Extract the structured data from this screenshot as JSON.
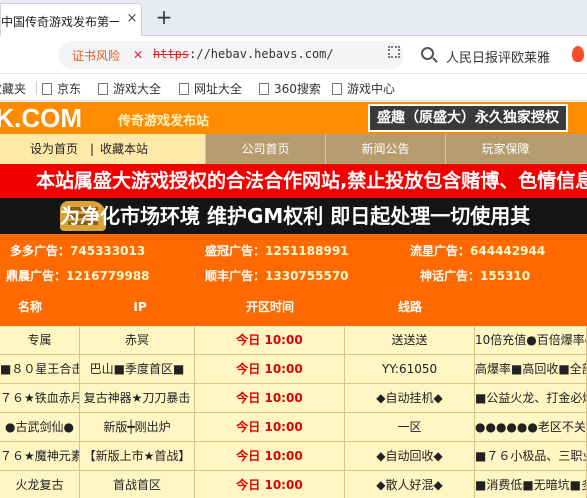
{
  "browser": {
    "tab_title": "中国传奇游戏发布第一",
    "tab_close": "×",
    "new_tab": "+",
    "risk_label": "证书风险",
    "url_scheme": "https",
    "url_rest": "://hebav.hebavs.com/",
    "search_text": "人民日报评欧莱雅",
    "bookmarks": [
      "收藏夹",
      "京东",
      "游戏大全",
      "网址大全",
      "360搜索",
      "游戏中心"
    ]
  },
  "site": {
    "logo": "PK.COM",
    "slogan": "传奇游戏发布站",
    "auth": "盛趣（原盛大）永久独家授权",
    "nav_left": [
      "设为首页",
      "|",
      "收藏本站"
    ],
    "nav_items": [
      "公司首页",
      "新闻公告",
      "玩家保障"
    ],
    "banner1": "本站属盛大游戏授权的合法合作网站,禁止投放包含赌博、色情信息",
    "banner2": "为净化市场环境  维护GM权利  即日起处理一切使用其"
  },
  "ads": [
    {
      "label": "多多广告：",
      "value": "745333013"
    },
    {
      "label": "盛冠广告：",
      "value": "1251188991"
    },
    {
      "label": "流星广告：",
      "value": "644442944"
    },
    {
      "label": "鼎晨广告：",
      "value": "1216779988"
    },
    {
      "label": "顺丰广告：",
      "value": "1330755570"
    },
    {
      "label": "神话广告：",
      "value": "155310"
    }
  ],
  "table": {
    "headers": [
      "名称",
      "IP",
      "开区时间",
      "线路",
      ""
    ],
    "rows": [
      [
        "专属",
        "赤冥",
        "今日 10:00",
        "送送送",
        "10倍充值●百倍爆率●"
      ],
      [
        "■８０星王合击",
        "巴山■季度首区■",
        "今日 10:00",
        "YY:61050",
        "高爆率■高回收■全部"
      ],
      [
        "７６★铁血赤月",
        "复古神器★刀刀暴击",
        "今日 10:00",
        "◆自动挂机◆",
        "■公益火龙、打金必爆"
      ],
      [
        "●古武剑仙●",
        "新版┿刚出炉",
        "今日 10:00",
        "一区",
        "●●●●●●老区不关"
      ],
      [
        "７６★魔神元素",
        "【新版上市★首战】",
        "今日 10:00",
        "◆自动回收◆",
        "■７６小极品、三职业"
      ],
      [
        "火龙复古",
        "首战首区",
        "今日 10:00",
        "◆散人好混◆",
        "■消费低■无暗坑■多"
      ]
    ]
  }
}
